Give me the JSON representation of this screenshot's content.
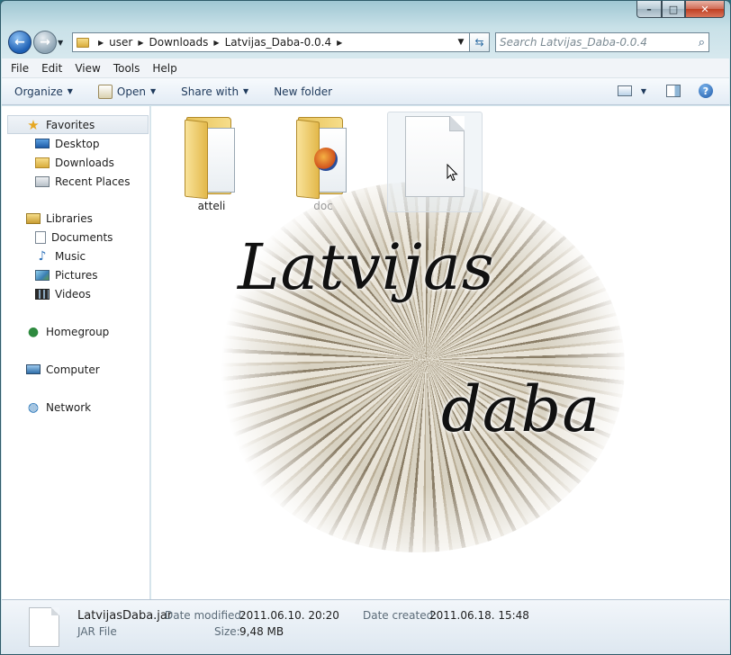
{
  "window": {
    "minimize": "–",
    "maximize": "□",
    "close": "✕"
  },
  "address": {
    "crumbs": [
      "user",
      "Downloads",
      "Latvijas_Daba-0.0.4"
    ],
    "search_placeholder": "Search Latvijas_Daba-0.0.4"
  },
  "menu": [
    "File",
    "Edit",
    "View",
    "Tools",
    "Help"
  ],
  "commands": {
    "organize": "Organize",
    "open": "Open",
    "share": "Share with",
    "new_folder": "New folder"
  },
  "nav": {
    "favorites": "Favorites",
    "favorites_items": [
      "Desktop",
      "Downloads",
      "Recent Places"
    ],
    "libraries": "Libraries",
    "libraries_items": [
      "Documents",
      "Music",
      "Pictures",
      "Videos"
    ],
    "homegroup": "Homegroup",
    "computer": "Computer",
    "network": "Network"
  },
  "files": [
    {
      "name": "atteli",
      "type": "folder"
    },
    {
      "name": "doc",
      "type": "folder"
    },
    {
      "name": "",
      "type": "file"
    }
  ],
  "splash": {
    "line1": "Latvijas",
    "line2": "daba"
  },
  "details": {
    "name": "LatvijasDaba.jar",
    "type": "JAR File",
    "modified_label": "Date modified:",
    "modified_value": "2011.06.10. 20:20",
    "created_label": "Date created:",
    "created_value": "2011.06.18. 15:48",
    "size_label": "Size:",
    "size_value": "9,48 MB"
  }
}
